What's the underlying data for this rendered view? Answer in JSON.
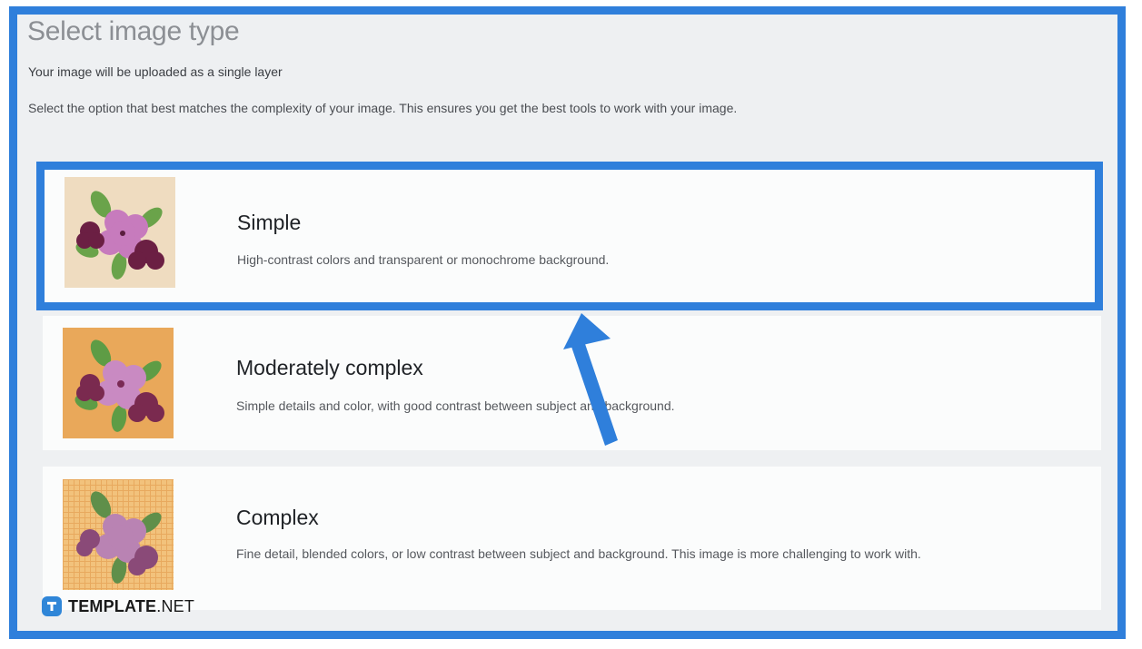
{
  "header": {
    "title": "Select image type",
    "subtitle": "Your image will be uploaded as a single layer",
    "instructions": "Select the option that best matches the complexity of your image. This ensures you get the best tools to work with your image."
  },
  "options": [
    {
      "name": "Simple",
      "description": "High-contrast colors and transparent or monochrome background.",
      "selected": true,
      "thumb_bg": "#efdcc0"
    },
    {
      "name": "Moderately complex",
      "description": "Simple details and color, with good contrast between subject and background.",
      "selected": false,
      "thumb_bg": "#e9a85a"
    },
    {
      "name": "Complex",
      "description": "Fine detail, blended colors, or low contrast between subject and background. This image is more challenging to work with.",
      "selected": false,
      "thumb_bg": "#f2c27c"
    }
  ],
  "watermark": {
    "brand": "TEMPLATE",
    "suffix": ".NET"
  },
  "colors": {
    "highlight": "#2f7fdb",
    "panel_bg": "#eef0f2"
  },
  "icons": {
    "option_thumbnail": "flower-icon",
    "annotation": "arrow-up-icon",
    "logo": "template-logo-icon"
  }
}
